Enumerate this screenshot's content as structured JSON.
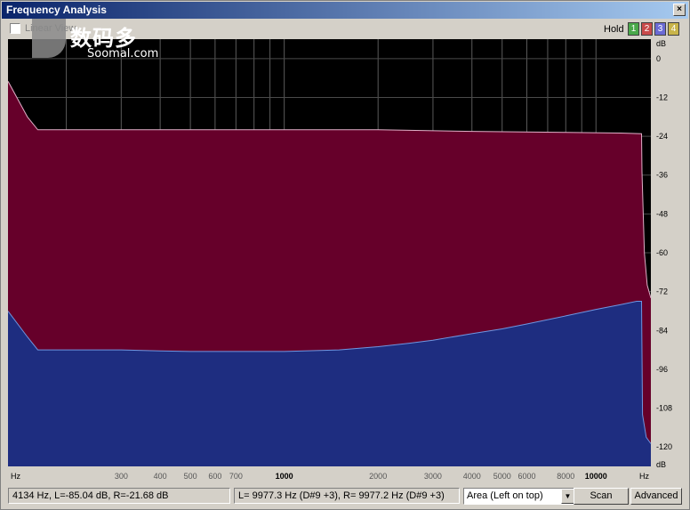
{
  "window": {
    "title": "Frequency Analysis",
    "close_label": "×"
  },
  "toolbar": {
    "linear_view_label": "Linear View",
    "hold_label": "Hold",
    "hold_buttons": [
      {
        "label": "1",
        "color": "#4aa84a"
      },
      {
        "label": "2",
        "color": "#c84a4a"
      },
      {
        "label": "3",
        "color": "#6a6ad4"
      },
      {
        "label": "4",
        "color": "#c8b44a"
      }
    ]
  },
  "watermark": {
    "cn": "数码多",
    "en": "Soomal.com"
  },
  "chart_data": {
    "type": "area",
    "x_scale": "log",
    "x_unit": "Hz",
    "y_unit": "dB",
    "ylim": [
      -126,
      6
    ],
    "grid": true,
    "x_ticks": [
      300,
      400,
      500,
      600,
      700,
      1000,
      2000,
      3000,
      4000,
      5000,
      6000,
      8000,
      10000
    ],
    "x_tick_labels": [
      "300",
      "400",
      "500",
      "600",
      "700",
      "1000",
      "2000",
      "3000",
      "4000",
      "5000",
      "6000",
      "8000",
      "10000"
    ],
    "y_ticks": [
      0,
      -12,
      -24,
      -36,
      -48,
      -60,
      -72,
      -84,
      -96,
      -108,
      -120
    ],
    "y_tick_labels": [
      "0",
      "-12",
      "-24",
      "-36",
      "-48",
      "-60",
      "-72",
      "-84",
      "-96",
      "-108",
      "-120"
    ],
    "series": [
      {
        "colors": {
          "fill": "#66002a",
          "stroke": "#e0b0c8"
        },
        "x": [
          130,
          150,
          162,
          200,
          300,
          500,
          1000,
          2000,
          4000,
          8000,
          12000,
          14000,
          14050,
          14300,
          14600,
          15000
        ],
        "y": [
          -7,
          -18,
          -22,
          -22,
          -22,
          -22,
          -22,
          -22,
          -22.5,
          -22.8,
          -23,
          -23.2,
          -35,
          -60,
          -70,
          -74
        ]
      },
      {
        "colors": {
          "fill": "#1e2d80",
          "stroke": "#6f96e0"
        },
        "x": [
          130,
          150,
          162,
          200,
          300,
          400,
          500,
          700,
          1000,
          1500,
          2000,
          2500,
          3000,
          4000,
          5000,
          6000,
          8000,
          10000,
          12000,
          13500,
          14000,
          14100,
          14500,
          15000
        ],
        "y": [
          -78,
          -86,
          -90,
          -90,
          -90,
          -90.3,
          -90.5,
          -90.5,
          -90.5,
          -90,
          -89,
          -88,
          -87,
          -85,
          -83.5,
          -82,
          -79.5,
          -77.5,
          -76,
          -75,
          -75,
          -110,
          -117,
          -119
        ]
      }
    ]
  },
  "status": {
    "cursor_readout": "4134 Hz, L=-85.04 dB, R=-21.68 dB",
    "peak_readout": "L= 9977.3 Hz (D#9 +3), R= 9977.2 Hz (D#9 +3)",
    "view_mode": "Area (Left on top)",
    "view_arrow": "▼",
    "scan_label": "Scan",
    "advanced_label": "Advanced"
  }
}
